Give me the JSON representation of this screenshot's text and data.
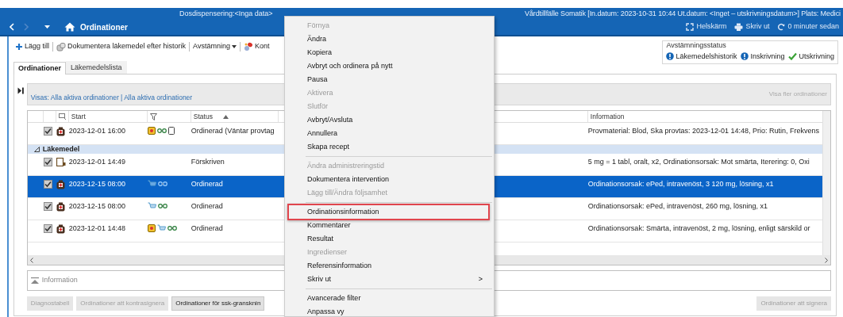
{
  "title_bar": {
    "left_text": "Dosdispensering:<Inga data>",
    "right_text": "Vårdtillfälle Somatik [In.datum: 2023-10-31 10:44 Ut.datum: <Inget – utskrivningsdatum>] Plats: Medici"
  },
  "nav": {
    "title": "Ordinationer",
    "forward_disabled": true,
    "actions": [
      {
        "label": "Helskärm",
        "kind": "fullscreen"
      },
      {
        "label": "Skriv ut",
        "kind": "print"
      },
      {
        "label": "0 minuter sedan",
        "kind": "refresh"
      }
    ]
  },
  "toolbar": [
    {
      "label": "Lägg till",
      "kind": "add"
    },
    {
      "label": "Dokumentera läkemedel efter historik",
      "kind": "document"
    },
    {
      "label": "Avstämning",
      "kind": "dropdown"
    },
    {
      "label": "Kont",
      "kind": "contact"
    }
  ],
  "reconciliation_status": {
    "title": "Avstämningsstatus",
    "items": [
      {
        "label": "Läkemedelshistorik",
        "done": false
      },
      {
        "label": "Inskrivning",
        "done": false
      },
      {
        "label": "Utskrivning",
        "done": true
      }
    ]
  },
  "tabs": [
    {
      "label": "Ordinationer",
      "selected": true
    },
    {
      "label": "Läkemedelslista",
      "selected": false
    }
  ],
  "filter_bar": {
    "shown": "Visas: Alla aktiva ordinationer | Alla aktiva ordinationer",
    "more": {
      "label": "Visa fler ordinationer",
      "disabled": true
    }
  },
  "table": {
    "columns": [
      {
        "label": "Start",
        "kind": "start"
      },
      {
        "label": "Status",
        "kind": "status",
        "sort_ascending": true
      },
      {
        "label": "Information",
        "kind": "info"
      }
    ],
    "rows": [
      {
        "kind": "row",
        "selected": false,
        "checked": true,
        "prescription": false,
        "alert": true,
        "cart": false,
        "glasses": true,
        "device": true,
        "start": "2023-12-01 16:00",
        "status": "Ordinerad (Väntar provtag",
        "information": "Provmaterial: Blod, Ska provtas: 2023-12-01 14:48, Prio: Rutin, Frekvens"
      },
      {
        "kind": "group",
        "label": "Läkemedel",
        "expanded": true
      },
      {
        "kind": "row",
        "selected": false,
        "checked": true,
        "prescription": true,
        "alert": false,
        "cart": false,
        "glasses": false,
        "device": false,
        "start": "2023-12-01 14:49",
        "status": "Förskriven",
        "information": "5 mg = 1 tabl, oralt, x2, Ordinationsorsak: Mot smärta, Iterering: 0, Oxi"
      },
      {
        "kind": "row",
        "selected": true,
        "checked": true,
        "prescription": false,
        "alert": false,
        "cart": true,
        "glasses": true,
        "device": false,
        "start": "2023-12-15 08:00",
        "status": "Ordinerad",
        "information": "Ordinationsorsak: ePed, intravenöst, 3 120 mg, lösning, x1"
      },
      {
        "kind": "row",
        "selected": false,
        "checked": true,
        "prescription": false,
        "alert": false,
        "cart": true,
        "glasses": true,
        "device": false,
        "start": "2023-12-15 08:00",
        "status": "Ordinerad",
        "information": "Ordinationsorsak: ePed, intravenöst, 260 mg, lösning, x1"
      },
      {
        "kind": "row",
        "selected": false,
        "checked": true,
        "prescription": false,
        "alert": true,
        "cart": true,
        "glasses": true,
        "device": false,
        "start": "2023-12-01 14:48",
        "status": "Ordinerad",
        "information": "Ordinationsorsak: Smärta, intravenöst, 2 mg, lösning, enligt särskild or"
      }
    ]
  },
  "information_panel": {
    "title": "Information",
    "expanded": false
  },
  "bottom_buttons": [
    {
      "label": "Diagnostabell",
      "disabled": true
    },
    {
      "label": "Ordinationer att kontrasignera",
      "disabled": true
    },
    {
      "label": "Ordinationer för ssk-gransknin",
      "disabled": false
    }
  ],
  "sign_button": {
    "label": "Ordinationer att signera",
    "disabled": true
  },
  "context_menu": [
    {
      "kind": "item",
      "label": "Förnya",
      "disabled": true
    },
    {
      "kind": "item",
      "label": "Ändra",
      "disabled": false,
      "highlighted": false
    },
    {
      "kind": "item",
      "label": "Kopiera",
      "disabled": false,
      "highlighted": false
    },
    {
      "kind": "item",
      "label": "Avbryt och ordinera på nytt",
      "disabled": false,
      "highlighted": false
    },
    {
      "kind": "item",
      "label": "Pausa",
      "disabled": false,
      "highlighted": false
    },
    {
      "kind": "item",
      "label": "Aktivera",
      "disabled": true,
      "highlighted": false
    },
    {
      "kind": "item",
      "label": "Slutför",
      "disabled": true,
      "highlighted": false
    },
    {
      "kind": "item",
      "label": "Avbryt/Avsluta",
      "disabled": false,
      "highlighted": false
    },
    {
      "kind": "item",
      "label": "Annullera",
      "disabled": false,
      "highlighted": false
    },
    {
      "kind": "item",
      "label": "Skapa recept",
      "disabled": false,
      "highlighted": false
    },
    {
      "kind": "separator"
    },
    {
      "kind": "item",
      "label": "Ändra administreringstid",
      "disabled": true,
      "highlighted": false
    },
    {
      "kind": "item",
      "label": "Dokumentera intervention",
      "disabled": false,
      "highlighted": false
    },
    {
      "kind": "item",
      "label": "Lägg till/Ändra följsamhet",
      "disabled": true,
      "highlighted": false
    },
    {
      "kind": "separator"
    },
    {
      "kind": "item",
      "label": "Ordinationsinformation",
      "disabled": false,
      "highlighted": true
    },
    {
      "kind": "item",
      "label": "Kommentarer",
      "disabled": false,
      "highlighted": false
    },
    {
      "kind": "item",
      "label": "Resultat",
      "disabled": false,
      "highlighted": false
    },
    {
      "kind": "item",
      "label": "Ingredienser",
      "disabled": true,
      "highlighted": false
    },
    {
      "kind": "item",
      "label": "Referensinformation",
      "disabled": false,
      "highlighted": false
    },
    {
      "kind": "submenu",
      "label": "Skriv ut",
      "arrow": ">",
      "disabled": false,
      "highlighted": false
    },
    {
      "kind": "separator"
    },
    {
      "kind": "item",
      "label": "Avancerade filter",
      "disabled": false,
      "highlighted": false
    },
    {
      "kind": "item",
      "label": "Anpassa vy",
      "disabled": false,
      "highlighted": false
    }
  ]
}
